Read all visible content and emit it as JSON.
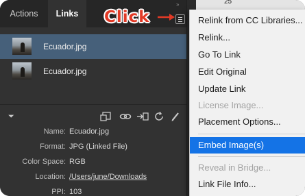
{
  "panel": {
    "tabs": [
      {
        "label": "Actions"
      },
      {
        "label": "Links"
      }
    ],
    "collapse_glyph": "»",
    "links": [
      {
        "name": "Ecuador.jpg",
        "selected": true
      },
      {
        "name": "Ecuador.jpg",
        "selected": false
      }
    ],
    "toolbar": {
      "expand": "⏷",
      "icons": [
        "relink-from-cc-icon",
        "relink-chain-icon",
        "go-to-link-icon",
        "update-link-icon",
        "edit-original-icon"
      ]
    },
    "info": [
      {
        "label": "Name:",
        "value": "Ecuador.jpg"
      },
      {
        "label": "Format:",
        "value": "JPG (Linked File)"
      },
      {
        "label": "Color Space:",
        "value": "RGB"
      },
      {
        "label": "Location:",
        "value": "/Users/june/Downloads"
      },
      {
        "label": "PPI:",
        "value": "103"
      }
    ]
  },
  "annotation": {
    "label": "Click",
    "color": "#e23a26"
  },
  "ruler": {
    "label": "25"
  },
  "menu": {
    "items": [
      {
        "label": "Relink from CC Libraries..."
      },
      {
        "label": "Relink..."
      },
      {
        "label": "Go To Link"
      },
      {
        "label": "Edit Original"
      },
      {
        "label": "Update Link"
      },
      {
        "label": "License Image..."
      },
      {
        "label": "Placement Options..."
      },
      {
        "label": "Embed Image(s)"
      },
      {
        "label": "Reveal in Bridge..."
      },
      {
        "label": "Link File Info..."
      }
    ],
    "highlight_color": "#1473e6"
  }
}
